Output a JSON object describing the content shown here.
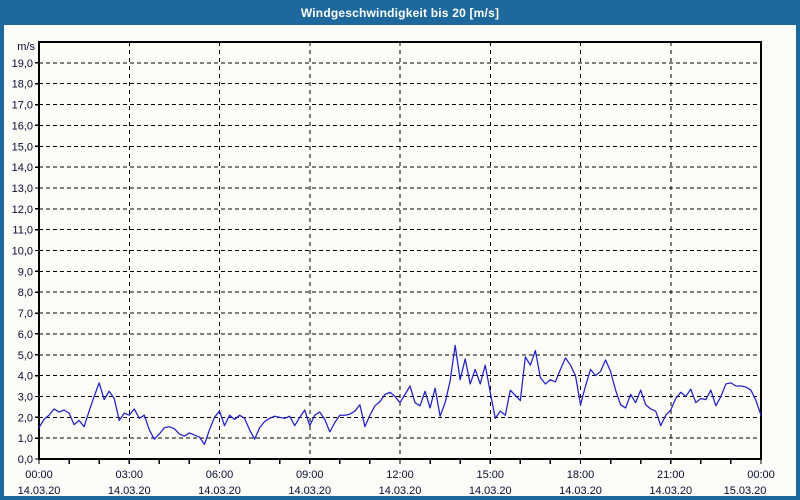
{
  "window": {
    "title": "Windgeschwindigkeit bis 20 [m/s]",
    "titlebar_color": "#1D699E",
    "border_color": "#1D699E",
    "background_color": "#FCFCF8"
  },
  "chart_data": {
    "type": "line",
    "title": "Windgeschwindigkeit bis 20 [m/s]",
    "ylabel": "m/s",
    "xlabel": "",
    "ylim": [
      0,
      20
    ],
    "y_tick_step": 1.0,
    "y_tick_labels": [
      "0,0",
      "1,0",
      "2,0",
      "3,0",
      "4,0",
      "5,0",
      "6,0",
      "7,0",
      "8,0",
      "9,0",
      "10,0",
      "11,0",
      "12,0",
      "13,0",
      "14,0",
      "15,0",
      "16,0",
      "17,0",
      "18,0",
      "19,0"
    ],
    "grid": "dashed",
    "legend_position": "none",
    "x_axis": {
      "span_hours": 24,
      "major_tick_every_hours": 3,
      "minor_tick_every_hours": 1,
      "major_ticks": [
        {
          "hour": 0,
          "time": "00:00",
          "date": "14.03.20"
        },
        {
          "hour": 3,
          "time": "03:00",
          "date": "14.03.20"
        },
        {
          "hour": 6,
          "time": "06:00",
          "date": "14.03.20"
        },
        {
          "hour": 9,
          "time": "09:00",
          "date": "14.03.20"
        },
        {
          "hour": 12,
          "time": "12:00",
          "date": "14.03.20"
        },
        {
          "hour": 15,
          "time": "15:00",
          "date": "14.03.20"
        },
        {
          "hour": 18,
          "time": "18:00",
          "date": "14.03.20"
        },
        {
          "hour": 21,
          "time": "21:00",
          "date": "14.03.20"
        },
        {
          "hour": 24,
          "time": "00:00",
          "date": "15.03.20"
        }
      ]
    },
    "colors": {
      "line": "#2121C8",
      "grid": "#000000",
      "axis": "#000000",
      "text": "#0B0B33"
    },
    "series": [
      {
        "name": "Windgeschwindigkeit",
        "unit": "m/s",
        "interval_minutes": 10,
        "start": "14.03.20 00:00",
        "values": [
          1.5,
          1.9,
          2.1,
          2.4,
          2.25,
          2.35,
          2.2,
          1.65,
          1.85,
          1.55,
          2.3,
          3.0,
          3.65,
          2.85,
          3.25,
          2.9,
          1.85,
          2.2,
          2.1,
          2.4,
          1.95,
          2.1,
          1.4,
          0.95,
          1.2,
          1.5,
          1.55,
          1.45,
          1.2,
          1.1,
          1.25,
          1.15,
          1.05,
          0.7,
          1.4,
          2.0,
          2.3,
          1.6,
          2.1,
          1.9,
          2.1,
          1.95,
          1.4,
          0.95,
          1.5,
          1.8,
          1.95,
          2.05,
          2.0,
          1.95,
          2.05,
          1.6,
          2.0,
          2.35,
          1.6,
          2.1,
          2.25,
          1.9,
          1.3,
          1.75,
          2.1,
          2.1,
          2.15,
          2.3,
          2.6,
          1.55,
          2.1,
          2.55,
          2.75,
          3.1,
          3.2,
          3.0,
          2.7,
          3.1,
          3.5,
          2.7,
          2.55,
          3.25,
          2.45,
          3.4,
          2.05,
          2.7,
          3.75,
          5.45,
          3.8,
          4.8,
          3.6,
          4.3,
          3.6,
          4.5,
          3.2,
          1.95,
          2.3,
          2.1,
          3.3,
          3.05,
          2.8,
          4.9,
          4.5,
          5.2,
          3.9,
          3.6,
          3.8,
          3.7,
          4.3,
          4.85,
          4.5,
          4.0,
          2.6,
          3.5,
          4.3,
          4.0,
          4.2,
          4.75,
          4.2,
          3.3,
          2.6,
          2.45,
          3.1,
          2.7,
          3.3,
          2.6,
          2.4,
          2.3,
          1.6,
          2.1,
          2.35,
          2.9,
          3.2,
          3.0,
          3.35,
          2.7,
          2.9,
          2.85,
          3.3,
          2.55,
          3.0,
          3.6,
          3.65,
          3.5,
          3.5,
          3.45,
          3.3,
          2.8,
          2.1
        ]
      }
    ]
  }
}
